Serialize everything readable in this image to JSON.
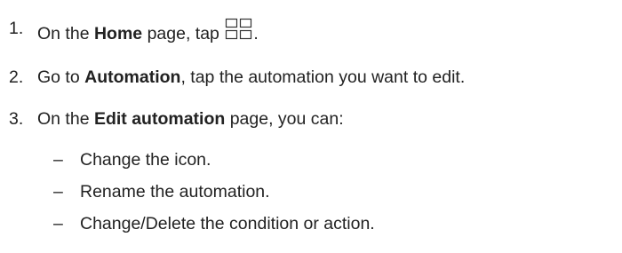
{
  "steps": [
    {
      "number": "1.",
      "pre": "On the ",
      "bold": "Home",
      "post": " page, tap ",
      "icon": "grid-icon",
      "after_icon": "."
    },
    {
      "number": "2.",
      "pre": "Go to ",
      "bold": "Automation",
      "post": ", tap the automation you want to edit."
    },
    {
      "number": "3.",
      "pre": "On the ",
      "bold": "Edit automation",
      "post": " page, you can:"
    }
  ],
  "sub_items": [
    {
      "dash": "–",
      "text": "Change the icon."
    },
    {
      "dash": "–",
      "text": "Rename the automation."
    },
    {
      "dash": "–",
      "text": "Change/Delete the condition or action."
    }
  ]
}
